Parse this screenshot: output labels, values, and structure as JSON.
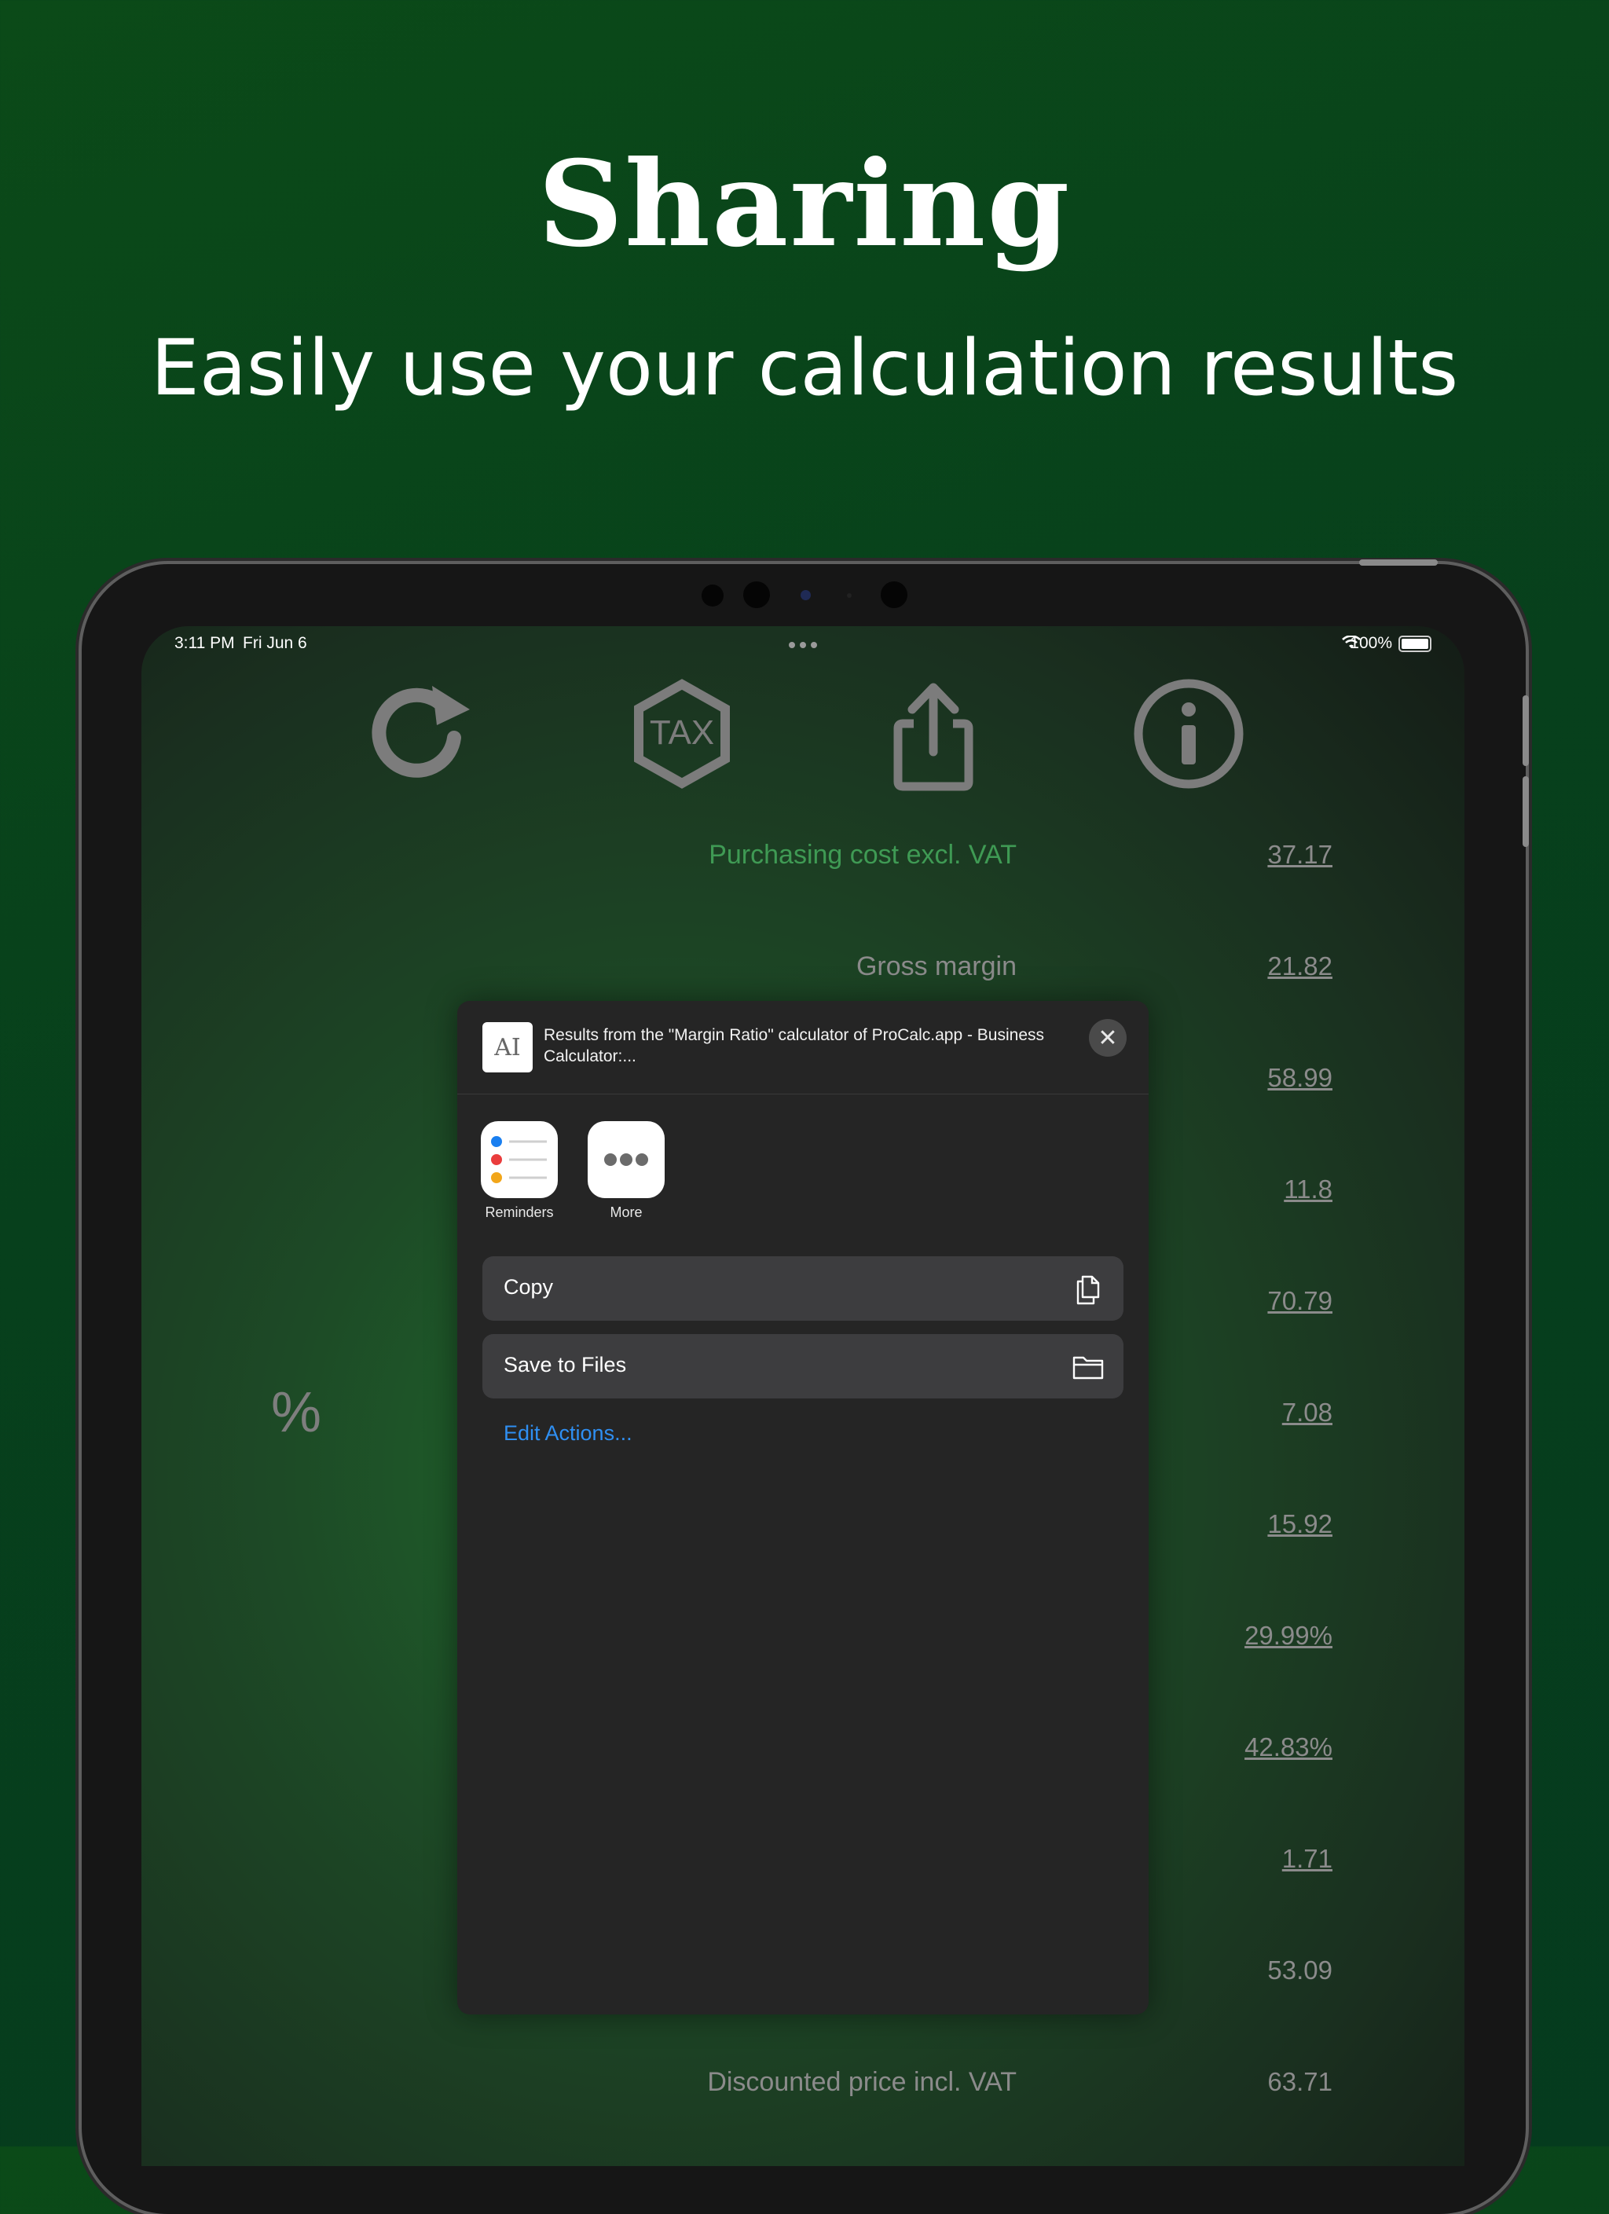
{
  "hero": {
    "title": "Sharing",
    "subtitle": "Easily use your calculation results"
  },
  "status_bar": {
    "time": "3:11 PM",
    "date": "Fri Jun 6",
    "battery": "100%"
  },
  "toolbar": {
    "tax_label": "TAX"
  },
  "calc_rows": [
    {
      "label": "Purchasing cost excl. VAT",
      "value": "37.17"
    },
    {
      "label": "Gross margin",
      "value": "21.82"
    },
    {
      "label": "",
      "value": "58.99"
    },
    {
      "label": "",
      "value": "11.8"
    },
    {
      "label": "",
      "value": "70.79"
    },
    {
      "label": "",
      "value": "7.08"
    },
    {
      "label": "",
      "value": "15.92"
    },
    {
      "label": "",
      "value": "29.99%"
    },
    {
      "label": "",
      "value": "42.83%"
    },
    {
      "label": "",
      "value": "1.71"
    },
    {
      "label": "",
      "value": "53.09"
    },
    {
      "label": "Discounted price incl. VAT",
      "value": "63.71"
    }
  ],
  "percent_symbol": "%",
  "share_sheet": {
    "doc_icon_text": "AI",
    "summary": "Results from the \"Margin Ratio\" calculator of ProCalc.app - Business Calculator:...",
    "close": "✕",
    "apps": [
      {
        "label": "Reminders",
        "icon": "reminders-icon"
      },
      {
        "label": "More",
        "icon": "more-icon"
      }
    ],
    "actions": [
      {
        "label": "Copy",
        "icon": "copy-icon"
      },
      {
        "label": "Save to Files",
        "icon": "folder-icon"
      }
    ],
    "edit_actions": "Edit Actions..."
  },
  "colors": {
    "highlight_row": "#3f9a54",
    "link": "#2f8ff2",
    "sheet_bg": "#252525"
  }
}
